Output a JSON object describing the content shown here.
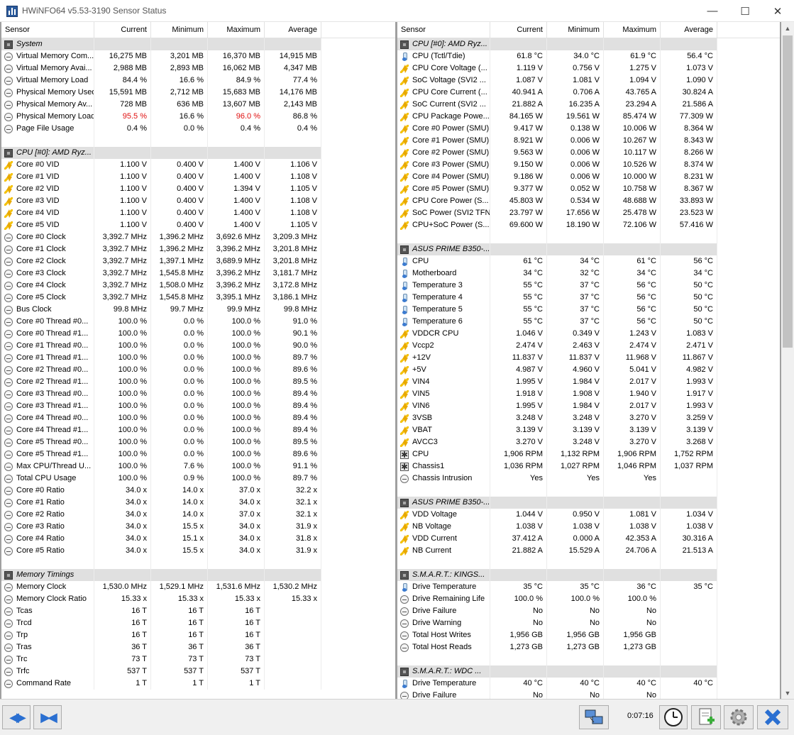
{
  "window": {
    "title": "HWiNFO64 v5.53-3190 Sensor Status",
    "minimize": "—",
    "maximize": "☐",
    "close": "✕"
  },
  "columns": [
    "Sensor",
    "Current",
    "Minimum",
    "Maximum",
    "Average"
  ],
  "left": [
    {
      "t": "group",
      "name": "System",
      "icon": "chip"
    },
    {
      "name": "Virtual Memory Com...",
      "icon": "clock",
      "v": [
        "16,275 MB",
        "3,201 MB",
        "16,370 MB",
        "14,915 MB"
      ]
    },
    {
      "name": "Virtual Memory Avai...",
      "icon": "clock",
      "v": [
        "2,988 MB",
        "2,893 MB",
        "16,062 MB",
        "4,347 MB"
      ]
    },
    {
      "name": "Virtual Memory Load",
      "icon": "clock",
      "v": [
        "84.4 %",
        "16.6 %",
        "84.9 %",
        "77.4 %"
      ]
    },
    {
      "name": "Physical Memory Used",
      "icon": "clock",
      "v": [
        "15,591 MB",
        "2,712 MB",
        "15,683 MB",
        "14,176 MB"
      ]
    },
    {
      "name": "Physical Memory Av...",
      "icon": "clock",
      "v": [
        "728 MB",
        "636 MB",
        "13,607 MB",
        "2,143 MB"
      ]
    },
    {
      "name": "Physical Memory Load",
      "icon": "clock",
      "v": [
        "95.5 %",
        "16.6 %",
        "96.0 %",
        "86.8 %"
      ],
      "red": [
        0,
        2
      ]
    },
    {
      "name": "Page File Usage",
      "icon": "clock",
      "v": [
        "0.4 %",
        "0.0 %",
        "0.4 %",
        "0.4 %"
      ]
    },
    {
      "t": "blank"
    },
    {
      "t": "group",
      "name": "CPU [#0]: AMD Ryz...",
      "icon": "chip"
    },
    {
      "name": "Core #0 VID",
      "icon": "volt",
      "v": [
        "1.100 V",
        "0.400 V",
        "1.400 V",
        "1.106 V"
      ]
    },
    {
      "name": "Core #1 VID",
      "icon": "volt",
      "v": [
        "1.100 V",
        "0.400 V",
        "1.400 V",
        "1.108 V"
      ]
    },
    {
      "name": "Core #2 VID",
      "icon": "volt",
      "v": [
        "1.100 V",
        "0.400 V",
        "1.394 V",
        "1.105 V"
      ]
    },
    {
      "name": "Core #3 VID",
      "icon": "volt",
      "v": [
        "1.100 V",
        "0.400 V",
        "1.400 V",
        "1.108 V"
      ]
    },
    {
      "name": "Core #4 VID",
      "icon": "volt",
      "v": [
        "1.100 V",
        "0.400 V",
        "1.400 V",
        "1.108 V"
      ]
    },
    {
      "name": "Core #5 VID",
      "icon": "volt",
      "v": [
        "1.100 V",
        "0.400 V",
        "1.400 V",
        "1.105 V"
      ]
    },
    {
      "name": "Core #0 Clock",
      "icon": "clock",
      "v": [
        "3,392.7 MHz",
        "1,396.2 MHz",
        "3,692.6 MHz",
        "3,209.3 MHz"
      ]
    },
    {
      "name": "Core #1 Clock",
      "icon": "clock",
      "v": [
        "3,392.7 MHz",
        "1,396.2 MHz",
        "3,396.2 MHz",
        "3,201.8 MHz"
      ]
    },
    {
      "name": "Core #2 Clock",
      "icon": "clock",
      "v": [
        "3,392.7 MHz",
        "1,397.1 MHz",
        "3,689.9 MHz",
        "3,201.8 MHz"
      ]
    },
    {
      "name": "Core #3 Clock",
      "icon": "clock",
      "v": [
        "3,392.7 MHz",
        "1,545.8 MHz",
        "3,396.2 MHz",
        "3,181.7 MHz"
      ]
    },
    {
      "name": "Core #4 Clock",
      "icon": "clock",
      "v": [
        "3,392.7 MHz",
        "1,508.0 MHz",
        "3,396.2 MHz",
        "3,172.8 MHz"
      ]
    },
    {
      "name": "Core #5 Clock",
      "icon": "clock",
      "v": [
        "3,392.7 MHz",
        "1,545.8 MHz",
        "3,395.1 MHz",
        "3,186.1 MHz"
      ]
    },
    {
      "name": "Bus Clock",
      "icon": "clock",
      "v": [
        "99.8 MHz",
        "99.7 MHz",
        "99.9 MHz",
        "99.8 MHz"
      ]
    },
    {
      "name": "Core #0 Thread #0...",
      "icon": "clock",
      "v": [
        "100.0 %",
        "0.0 %",
        "100.0 %",
        "91.0 %"
      ]
    },
    {
      "name": "Core #0 Thread #1...",
      "icon": "clock",
      "v": [
        "100.0 %",
        "0.0 %",
        "100.0 %",
        "90.1 %"
      ]
    },
    {
      "name": "Core #1 Thread #0...",
      "icon": "clock",
      "v": [
        "100.0 %",
        "0.0 %",
        "100.0 %",
        "90.0 %"
      ]
    },
    {
      "name": "Core #1 Thread #1...",
      "icon": "clock",
      "v": [
        "100.0 %",
        "0.0 %",
        "100.0 %",
        "89.7 %"
      ]
    },
    {
      "name": "Core #2 Thread #0...",
      "icon": "clock",
      "v": [
        "100.0 %",
        "0.0 %",
        "100.0 %",
        "89.6 %"
      ]
    },
    {
      "name": "Core #2 Thread #1...",
      "icon": "clock",
      "v": [
        "100.0 %",
        "0.0 %",
        "100.0 %",
        "89.5 %"
      ]
    },
    {
      "name": "Core #3 Thread #0...",
      "icon": "clock",
      "v": [
        "100.0 %",
        "0.0 %",
        "100.0 %",
        "89.4 %"
      ]
    },
    {
      "name": "Core #3 Thread #1...",
      "icon": "clock",
      "v": [
        "100.0 %",
        "0.0 %",
        "100.0 %",
        "89.4 %"
      ]
    },
    {
      "name": "Core #4 Thread #0...",
      "icon": "clock",
      "v": [
        "100.0 %",
        "0.0 %",
        "100.0 %",
        "89.4 %"
      ]
    },
    {
      "name": "Core #4 Thread #1...",
      "icon": "clock",
      "v": [
        "100.0 %",
        "0.0 %",
        "100.0 %",
        "89.4 %"
      ]
    },
    {
      "name": "Core #5 Thread #0...",
      "icon": "clock",
      "v": [
        "100.0 %",
        "0.0 %",
        "100.0 %",
        "89.5 %"
      ]
    },
    {
      "name": "Core #5 Thread #1...",
      "icon": "clock",
      "v": [
        "100.0 %",
        "0.0 %",
        "100.0 %",
        "89.6 %"
      ]
    },
    {
      "name": "Max CPU/Thread U...",
      "icon": "clock",
      "v": [
        "100.0 %",
        "7.6 %",
        "100.0 %",
        "91.1 %"
      ]
    },
    {
      "name": "Total CPU Usage",
      "icon": "clock",
      "v": [
        "100.0 %",
        "0.9 %",
        "100.0 %",
        "89.7 %"
      ]
    },
    {
      "name": "Core #0 Ratio",
      "icon": "clock",
      "v": [
        "34.0 x",
        "14.0 x",
        "37.0 x",
        "32.2 x"
      ]
    },
    {
      "name": "Core #1 Ratio",
      "icon": "clock",
      "v": [
        "34.0 x",
        "14.0 x",
        "34.0 x",
        "32.1 x"
      ]
    },
    {
      "name": "Core #2 Ratio",
      "icon": "clock",
      "v": [
        "34.0 x",
        "14.0 x",
        "37.0 x",
        "32.1 x"
      ]
    },
    {
      "name": "Core #3 Ratio",
      "icon": "clock",
      "v": [
        "34.0 x",
        "15.5 x",
        "34.0 x",
        "31.9 x"
      ]
    },
    {
      "name": "Core #4 Ratio",
      "icon": "clock",
      "v": [
        "34.0 x",
        "15.1 x",
        "34.0 x",
        "31.8 x"
      ]
    },
    {
      "name": "Core #5 Ratio",
      "icon": "clock",
      "v": [
        "34.0 x",
        "15.5 x",
        "34.0 x",
        "31.9 x"
      ]
    },
    {
      "t": "blank"
    },
    {
      "t": "group",
      "name": "Memory Timings",
      "icon": "chip"
    },
    {
      "name": "Memory Clock",
      "icon": "clock",
      "v": [
        "1,530.0 MHz",
        "1,529.1 MHz",
        "1,531.6 MHz",
        "1,530.2 MHz"
      ]
    },
    {
      "name": "Memory Clock Ratio",
      "icon": "clock",
      "v": [
        "15.33 x",
        "15.33 x",
        "15.33 x",
        "15.33 x"
      ]
    },
    {
      "name": "Tcas",
      "icon": "clock",
      "v": [
        "16 T",
        "16 T",
        "16 T",
        ""
      ]
    },
    {
      "name": "Trcd",
      "icon": "clock",
      "v": [
        "16 T",
        "16 T",
        "16 T",
        ""
      ]
    },
    {
      "name": "Trp",
      "icon": "clock",
      "v": [
        "16 T",
        "16 T",
        "16 T",
        ""
      ]
    },
    {
      "name": "Tras",
      "icon": "clock",
      "v": [
        "36 T",
        "36 T",
        "36 T",
        ""
      ]
    },
    {
      "name": "Trc",
      "icon": "clock",
      "v": [
        "73 T",
        "73 T",
        "73 T",
        ""
      ]
    },
    {
      "name": "Trfc",
      "icon": "clock",
      "v": [
        "537 T",
        "537 T",
        "537 T",
        ""
      ]
    },
    {
      "name": "Command Rate",
      "icon": "clock",
      "v": [
        "1 T",
        "1 T",
        "1 T",
        ""
      ]
    }
  ],
  "right": [
    {
      "t": "group",
      "name": "CPU [#0]: AMD Ryz...",
      "icon": "chip"
    },
    {
      "name": "CPU (Tctl/Tdie)",
      "icon": "therm",
      "v": [
        "61.8 °C",
        "34.0 °C",
        "61.9 °C",
        "56.4 °C"
      ]
    },
    {
      "name": "CPU Core Voltage (...",
      "icon": "volt",
      "v": [
        "1.119 V",
        "0.756 V",
        "1.275 V",
        "1.073 V"
      ]
    },
    {
      "name": "SoC Voltage (SVI2 ...",
      "icon": "volt",
      "v": [
        "1.087 V",
        "1.081 V",
        "1.094 V",
        "1.090 V"
      ]
    },
    {
      "name": "CPU Core Current (...",
      "icon": "volt",
      "v": [
        "40.941 A",
        "0.706 A",
        "43.765 A",
        "30.824 A"
      ]
    },
    {
      "name": "SoC Current (SVI2 ...",
      "icon": "volt",
      "v": [
        "21.882 A",
        "16.235 A",
        "23.294 A",
        "21.586 A"
      ]
    },
    {
      "name": "CPU Package Powe...",
      "icon": "volt",
      "v": [
        "84.165 W",
        "19.561 W",
        "85.474 W",
        "77.309 W"
      ]
    },
    {
      "name": "Core #0 Power (SMU)",
      "icon": "volt",
      "v": [
        "9.417 W",
        "0.138 W",
        "10.006 W",
        "8.364 W"
      ]
    },
    {
      "name": "Core #1 Power (SMU)",
      "icon": "volt",
      "v": [
        "8.921 W",
        "0.006 W",
        "10.267 W",
        "8.343 W"
      ]
    },
    {
      "name": "Core #2 Power (SMU)",
      "icon": "volt",
      "v": [
        "9.563 W",
        "0.006 W",
        "10.117 W",
        "8.266 W"
      ]
    },
    {
      "name": "Core #3 Power (SMU)",
      "icon": "volt",
      "v": [
        "9.150 W",
        "0.006 W",
        "10.526 W",
        "8.374 W"
      ]
    },
    {
      "name": "Core #4 Power (SMU)",
      "icon": "volt",
      "v": [
        "9.186 W",
        "0.006 W",
        "10.000 W",
        "8.231 W"
      ]
    },
    {
      "name": "Core #5 Power (SMU)",
      "icon": "volt",
      "v": [
        "9.377 W",
        "0.052 W",
        "10.758 W",
        "8.367 W"
      ]
    },
    {
      "name": "CPU Core Power (S...",
      "icon": "volt",
      "v": [
        "45.803 W",
        "0.534 W",
        "48.688 W",
        "33.893 W"
      ]
    },
    {
      "name": "SoC Power (SVI2 TFN)",
      "icon": "volt",
      "v": [
        "23.797 W",
        "17.656 W",
        "25.478 W",
        "23.523 W"
      ]
    },
    {
      "name": "CPU+SoC Power (S...",
      "icon": "volt",
      "v": [
        "69.600 W",
        "18.190 W",
        "72.106 W",
        "57.416 W"
      ]
    },
    {
      "t": "blank"
    },
    {
      "t": "group",
      "name": "ASUS PRIME B350-...",
      "icon": "chip"
    },
    {
      "name": "CPU",
      "icon": "therm",
      "v": [
        "61 °C",
        "34 °C",
        "61 °C",
        "56 °C"
      ]
    },
    {
      "name": "Motherboard",
      "icon": "therm",
      "v": [
        "34 °C",
        "32 °C",
        "34 °C",
        "34 °C"
      ]
    },
    {
      "name": "Temperature 3",
      "icon": "therm",
      "v": [
        "55 °C",
        "37 °C",
        "56 °C",
        "50 °C"
      ]
    },
    {
      "name": "Temperature 4",
      "icon": "therm",
      "v": [
        "55 °C",
        "37 °C",
        "56 °C",
        "50 °C"
      ]
    },
    {
      "name": "Temperature 5",
      "icon": "therm",
      "v": [
        "55 °C",
        "37 °C",
        "56 °C",
        "50 °C"
      ]
    },
    {
      "name": "Temperature 6",
      "icon": "therm",
      "v": [
        "55 °C",
        "37 °C",
        "56 °C",
        "50 °C"
      ]
    },
    {
      "name": "VDDCR CPU",
      "icon": "volt",
      "v": [
        "1.046 V",
        "0.349 V",
        "1.243 V",
        "1.083 V"
      ]
    },
    {
      "name": "Vccp2",
      "icon": "volt",
      "v": [
        "2.474 V",
        "2.463 V",
        "2.474 V",
        "2.471 V"
      ]
    },
    {
      "name": "+12V",
      "icon": "volt",
      "v": [
        "11.837 V",
        "11.837 V",
        "11.968 V",
        "11.867 V"
      ]
    },
    {
      "name": "+5V",
      "icon": "volt",
      "v": [
        "4.987 V",
        "4.960 V",
        "5.041 V",
        "4.982 V"
      ]
    },
    {
      "name": "VIN4",
      "icon": "volt",
      "v": [
        "1.995 V",
        "1.984 V",
        "2.017 V",
        "1.993 V"
      ]
    },
    {
      "name": "VIN5",
      "icon": "volt",
      "v": [
        "1.918 V",
        "1.908 V",
        "1.940 V",
        "1.917 V"
      ]
    },
    {
      "name": "VIN6",
      "icon": "volt",
      "v": [
        "1.995 V",
        "1.984 V",
        "2.017 V",
        "1.993 V"
      ]
    },
    {
      "name": "3VSB",
      "icon": "volt",
      "v": [
        "3.248 V",
        "3.248 V",
        "3.270 V",
        "3.259 V"
      ]
    },
    {
      "name": "VBAT",
      "icon": "volt",
      "v": [
        "3.139 V",
        "3.139 V",
        "3.139 V",
        "3.139 V"
      ]
    },
    {
      "name": "AVCC3",
      "icon": "volt",
      "v": [
        "3.270 V",
        "3.248 V",
        "3.270 V",
        "3.268 V"
      ]
    },
    {
      "name": "CPU",
      "icon": "fan",
      "v": [
        "1,906 RPM",
        "1,132 RPM",
        "1,906 RPM",
        "1,752 RPM"
      ]
    },
    {
      "name": "Chassis1",
      "icon": "fan",
      "v": [
        "1,036 RPM",
        "1,027 RPM",
        "1,046 RPM",
        "1,037 RPM"
      ]
    },
    {
      "name": "Chassis Intrusion",
      "icon": "clock",
      "v": [
        "Yes",
        "Yes",
        "Yes",
        ""
      ]
    },
    {
      "t": "blank"
    },
    {
      "t": "group",
      "name": "ASUS PRIME B350-...",
      "icon": "chip"
    },
    {
      "name": "VDD Voltage",
      "icon": "volt",
      "v": [
        "1.044 V",
        "0.950 V",
        "1.081 V",
        "1.034 V"
      ]
    },
    {
      "name": "NB Voltage",
      "icon": "volt",
      "v": [
        "1.038 V",
        "1.038 V",
        "1.038 V",
        "1.038 V"
      ]
    },
    {
      "name": "VDD Current",
      "icon": "volt",
      "v": [
        "37.412 A",
        "0.000 A",
        "42.353 A",
        "30.316 A"
      ]
    },
    {
      "name": "NB Current",
      "icon": "volt",
      "v": [
        "21.882 A",
        "15.529 A",
        "24.706 A",
        "21.513 A"
      ]
    },
    {
      "t": "blank"
    },
    {
      "t": "group",
      "name": "S.M.A.R.T.: KINGS...",
      "icon": "chip"
    },
    {
      "name": "Drive Temperature",
      "icon": "therm",
      "v": [
        "35 °C",
        "35 °C",
        "36 °C",
        "35 °C"
      ]
    },
    {
      "name": "Drive Remaining Life",
      "icon": "clock",
      "v": [
        "100.0 %",
        "100.0 %",
        "100.0 %",
        ""
      ]
    },
    {
      "name": "Drive Failure",
      "icon": "clock",
      "v": [
        "No",
        "No",
        "No",
        ""
      ]
    },
    {
      "name": "Drive Warning",
      "icon": "clock",
      "v": [
        "No",
        "No",
        "No",
        ""
      ]
    },
    {
      "name": "Total Host Writes",
      "icon": "clock",
      "v": [
        "1,956 GB",
        "1,956 GB",
        "1,956 GB",
        ""
      ]
    },
    {
      "name": "Total Host Reads",
      "icon": "clock",
      "v": [
        "1,273 GB",
        "1,273 GB",
        "1,273 GB",
        ""
      ]
    },
    {
      "t": "blank"
    },
    {
      "t": "group",
      "name": "S.M.A.R.T.: WDC ...",
      "icon": "chip"
    },
    {
      "name": "Drive Temperature",
      "icon": "therm",
      "v": [
        "40 °C",
        "40 °C",
        "40 °C",
        "40 °C"
      ]
    },
    {
      "name": "Drive Failure",
      "icon": "clock",
      "v": [
        "No",
        "No",
        "No",
        ""
      ]
    }
  ],
  "status": {
    "timer": "0:07:16"
  }
}
